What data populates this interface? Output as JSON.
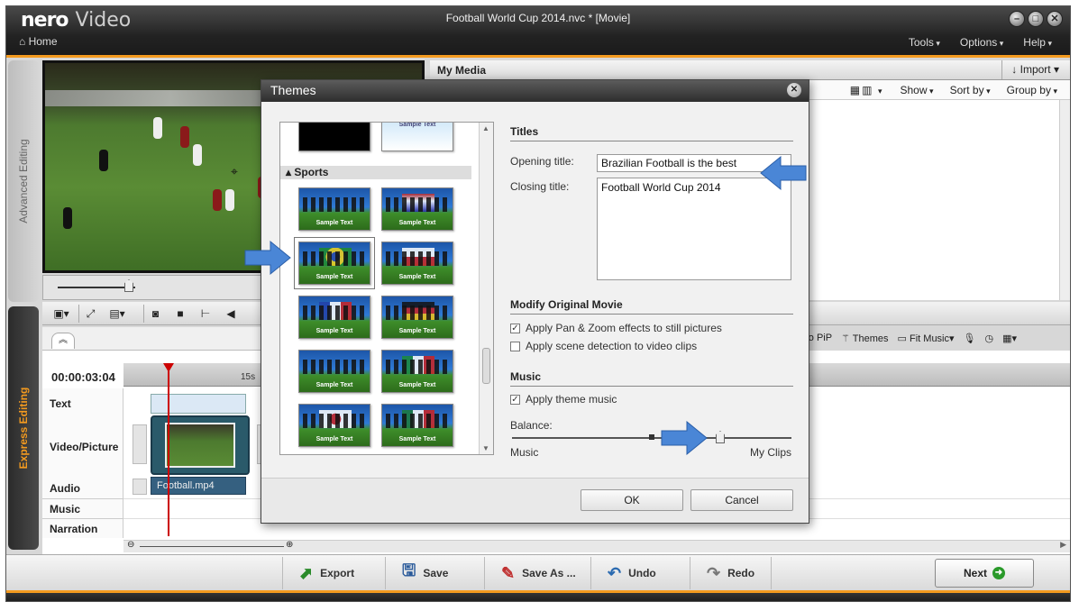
{
  "app": {
    "brand": "nero",
    "product": "Video",
    "window_title": "Football World Cup 2014.nvc * [Movie]",
    "home_label": "Home",
    "menus": [
      "Tools",
      "Options",
      "Help"
    ],
    "window_buttons": [
      "minimize",
      "maximize",
      "close"
    ]
  },
  "left_tabs": {
    "advanced": "Advanced Editing",
    "express": "Express Editing"
  },
  "media": {
    "title": "My Media",
    "import_label": "Import",
    "options": [
      "Show",
      "Sort by",
      "Group by"
    ]
  },
  "right_tools": [
    "ero PiP",
    "Themes",
    "Fit Music"
  ],
  "timeline": {
    "timecode": "00:00:03:04",
    "ruler_tick": "15s",
    "tracks": [
      "Text",
      "Video/Picture",
      "Audio",
      "Music",
      "Narration"
    ],
    "audio_clip": "Football.mp4"
  },
  "bottom_bar": {
    "export": "Export",
    "save": "Save",
    "save_as": "Save As ...",
    "undo": "Undo",
    "redo": "Redo",
    "next": "Next"
  },
  "dialog": {
    "title": "Themes",
    "category": "Sports",
    "sample_text": "Sample Text",
    "titles_group": "Titles",
    "opening_label": "Opening title:",
    "opening_value": "Brazilian Football is the best",
    "closing_label": "Closing title:",
    "closing_value": "Football World Cup 2014",
    "modify_group": "Modify Original Movie",
    "chk_pan_zoom": "Apply Pan & Zoom effects to still pictures",
    "chk_scene": "Apply scene detection to video clips",
    "music_group": "Music",
    "chk_theme_music": "Apply theme music",
    "balance_label": "Balance:",
    "balance_left": "Music",
    "balance_right": "My Clips",
    "ok": "OK",
    "cancel": "Cancel",
    "checks": {
      "pan_zoom": true,
      "scene": false,
      "theme_music": true
    }
  },
  "colors": {
    "accent": "#f39a1f",
    "annotation_arrow": "#4a86d6"
  }
}
